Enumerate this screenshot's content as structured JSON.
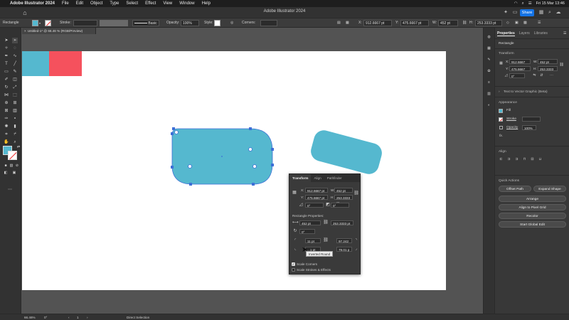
{
  "menubar": {
    "app": "Adobe Illustrator 2024",
    "items": [
      "File",
      "Edit",
      "Object",
      "Type",
      "Select",
      "Effect",
      "View",
      "Window",
      "Help"
    ],
    "clock": "Fri 15 Mar  13:46"
  },
  "titlebar": {
    "title": "Adobe Illustrator 2024",
    "share": "Share"
  },
  "controlbar": {
    "selection": "Rectangle",
    "stroke_label": "Stroke:",
    "brush": "Basic",
    "opacity_label": "Opacity:",
    "opacity": "100%",
    "style_label": "Style:",
    "corners_label": "Corners:",
    "x_label": "X:",
    "x": "912.6667 pt",
    "y_label": "Y:",
    "y": "475.6667 pt",
    "w_label": "W:",
    "w": "452 pt",
    "h_label": "H:",
    "h": "253.3333 pt"
  },
  "doctab": {
    "label": "Untitled-1* @ 66.46 % (RGB/Preview)"
  },
  "colors": {
    "teal": "#55b8cf",
    "red": "#f5515d",
    "accent": "#1473e6"
  },
  "transform_panel": {
    "tabs": [
      "Transform",
      "Align",
      "Pathfinder"
    ],
    "x_label": "X:",
    "x": "912.6667 pt",
    "y_label": "Y:",
    "y": "475.6667 pt",
    "w_label": "W:",
    "w": "452 pt",
    "h_label": "H:",
    "h": "253.3333 pt",
    "angle1": "0°",
    "angle2": "0°",
    "rect_props_label": "Rectangle Properties:",
    "rect_w": "452 pt",
    "rect_h": "253.3333 pt",
    "rect_angle": "0°",
    "corner1": "11 pt",
    "corner2": "97.242",
    "corner3": "...1 pt",
    "corner4": "79.01 p",
    "tooltip": "Inverted Round",
    "scale_corners": "Scale Corners",
    "scale_strokes": "Scale Strokes & Effects"
  },
  "properties": {
    "tabs": [
      "Properties",
      "Layers",
      "Libraries"
    ],
    "section": "Rectangle",
    "transform_label": "Transform",
    "x_label": "X:",
    "x": "912.6667",
    "w_label": "W:",
    "w": "452 pt",
    "y_label": "Y:",
    "y": "475.6667",
    "h_label": "H:",
    "h": "253.3333",
    "angle": "0°",
    "text_to_vector": "Text to Vector Graphic (Beta)",
    "appearance_label": "Appearance",
    "fill_label": "Fill",
    "stroke_label": "Stroke",
    "opacity_label": "Opacity",
    "opacity": "100%",
    "fx": "fx.",
    "align_label": "Align",
    "quick_actions_label": "Quick Actions",
    "offset_path": "Offset Path",
    "expand_shape": "Expand Shape",
    "arrange": "Arrange",
    "align_pixel_grid": "Align to Pixel Grid",
    "recolor": "Recolor",
    "start_global_edit": "Start Global Edit"
  },
  "statusbar": {
    "zoom": "66.46%",
    "rotation": "0°",
    "artboard": "1",
    "tool": "Direct Selection"
  }
}
